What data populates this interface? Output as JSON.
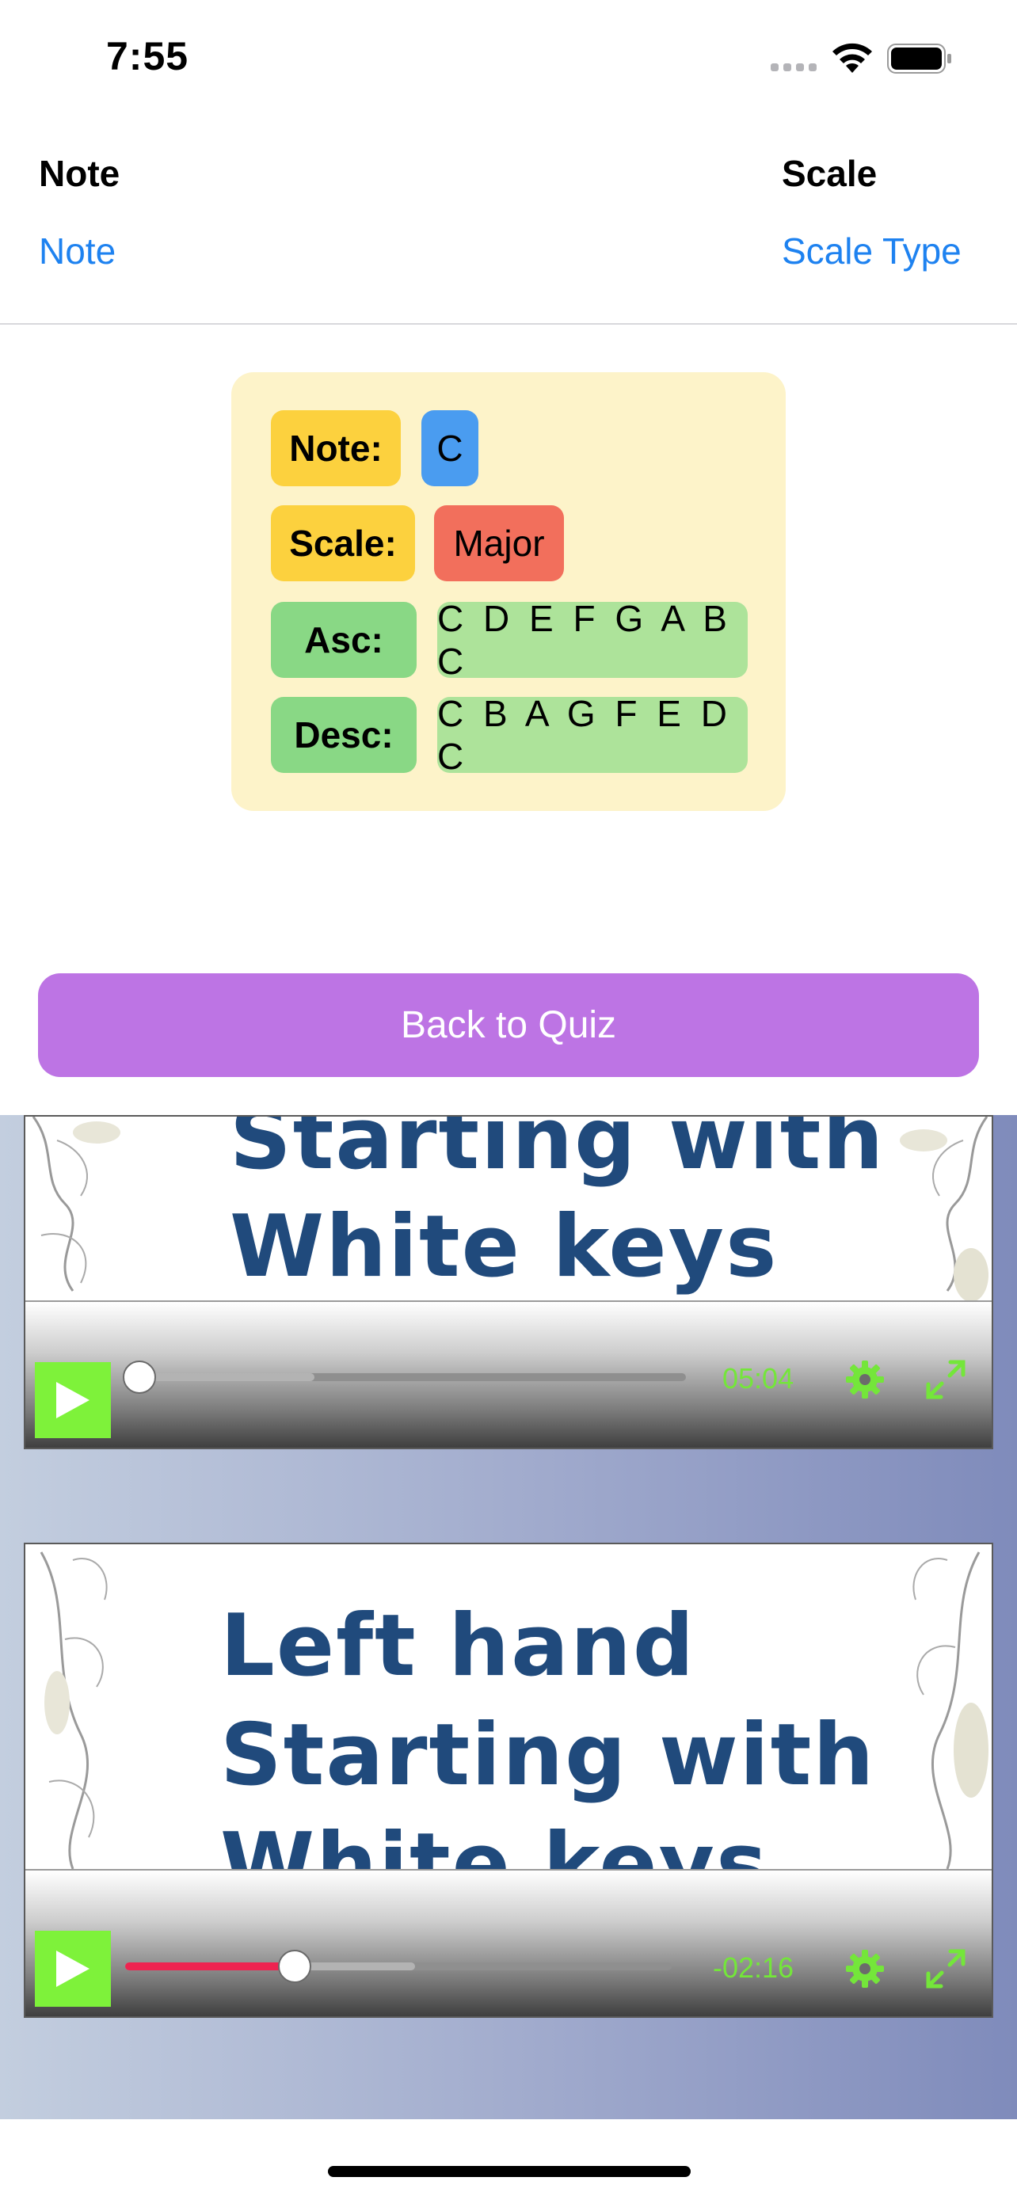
{
  "status_bar": {
    "time": "7:55"
  },
  "pickers": {
    "note": {
      "label": "Note",
      "value": "Note"
    },
    "scale": {
      "label": "Scale",
      "value": "Scale Type"
    }
  },
  "scale_card": {
    "note_label": "Note:",
    "note_value": "C",
    "scale_label": "Scale:",
    "scale_value": "Major",
    "asc_label": "Asc:",
    "asc_value": "C D E F G A B C",
    "desc_label": "Desc:",
    "desc_value": "C B A G F E D C"
  },
  "back_button": {
    "label": "Back to Quiz"
  },
  "videos": [
    {
      "slide_lines": [
        "Starting with",
        "White keys"
      ],
      "time": "05:04",
      "progress": 0.0,
      "buffered": 0.32
    },
    {
      "slide_lines": [
        "Left hand",
        "Starting with",
        "White keys"
      ],
      "time": "-02:16",
      "progress": 0.31,
      "buffered": 0.53
    }
  ],
  "colors": {
    "accent_blue": "#1e82f0",
    "button_purple": "#bd74e4",
    "card_bg": "#fdf3c9",
    "player_green": "#7ef23a",
    "progress_red": "#ee2350"
  }
}
